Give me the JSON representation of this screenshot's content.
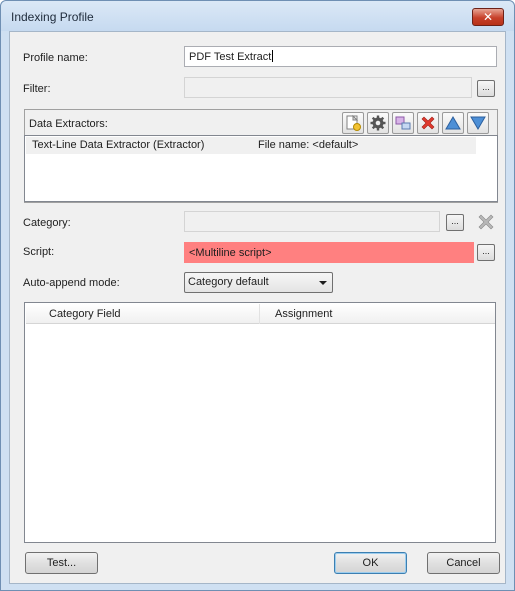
{
  "window": {
    "title": "Indexing Profile",
    "close_glyph": "✕"
  },
  "profile_name": {
    "label": "Profile name:",
    "value": "PDF Test Extract"
  },
  "filter": {
    "label": "Filter:",
    "value": "",
    "browse_label": "..."
  },
  "data_extractors": {
    "label": "Data Extractors:",
    "toolbar": [
      "add-icon",
      "gear-icon",
      "copy-icon",
      "delete-icon",
      "arrow-up-icon",
      "arrow-down-icon"
    ],
    "rows": [
      {
        "name": "Text-Line Data Extractor (Extractor)",
        "detail": "File name: <default>"
      }
    ]
  },
  "category": {
    "label": "Category:",
    "value": "",
    "browse_label": "...",
    "clear_icon": "clear-x-icon"
  },
  "script": {
    "label": "Script:",
    "value": "<Multiline script>",
    "browse_label": "...",
    "highlight_color": "#ff8080"
  },
  "auto_append": {
    "label": "Auto-append mode:",
    "selected": "Category default"
  },
  "assignments_table": {
    "columns": [
      "Category Field",
      "Assignment"
    ],
    "rows": []
  },
  "buttons": {
    "test": "Test...",
    "ok": "OK",
    "cancel": "Cancel"
  }
}
